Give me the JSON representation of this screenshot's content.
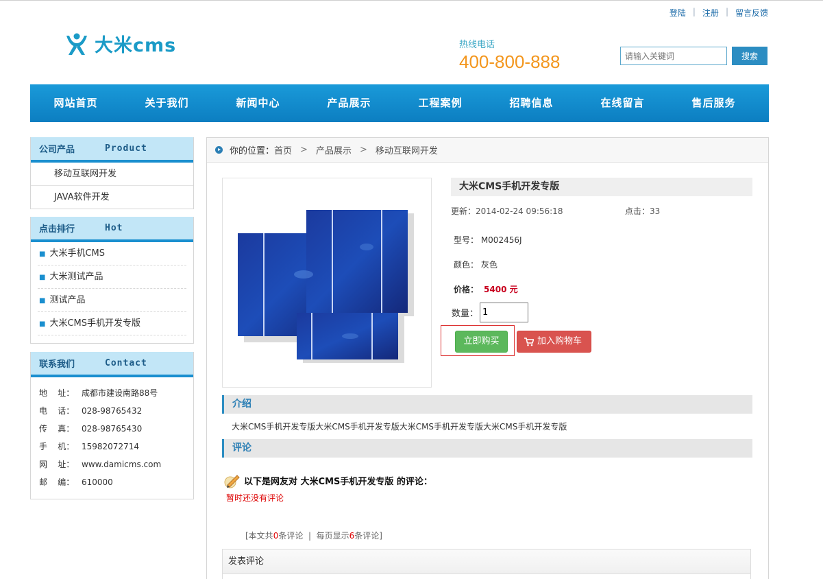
{
  "top_links": [
    "登陆",
    "注册",
    "留言反馈"
  ],
  "logo": {
    "text": "大米cms"
  },
  "hotline": {
    "label": "热线电话",
    "number": "400-800-888"
  },
  "search": {
    "placeholder": "请输入关键词",
    "button": "搜索"
  },
  "nav": [
    "网站首页",
    "关于我们",
    "新闻中心",
    "产品展示",
    "工程案例",
    "招聘信息",
    "在线留言",
    "售后服务"
  ],
  "sidebar": {
    "products": {
      "title": "公司产品",
      "title_en": "Product",
      "items": [
        "移动互联网开发",
        "JAVA软件开发"
      ]
    },
    "hot": {
      "title": "点击排行",
      "title_en": "Hot",
      "items": [
        "大米手机CMS",
        "大米测试产品",
        "测试产品",
        "大米CMS手机开发专版"
      ]
    },
    "contact": {
      "title": "联系我们",
      "title_en": "Contact",
      "rows": [
        {
          "k": "地    址：",
          "v": "成都市建设南路88号"
        },
        {
          "k": "电    话：",
          "v": "028-98765432"
        },
        {
          "k": "传    真：",
          "v": "028-98765430"
        },
        {
          "k": "手    机：",
          "v": "15982072714"
        },
        {
          "k": "网    址：",
          "v": "www.damicms.com"
        },
        {
          "k": "邮    编：",
          "v": "610000"
        }
      ]
    }
  },
  "breadcrumb": {
    "label": "你的位置：",
    "items": [
      "首页",
      "产品展示",
      "移动互联网开发"
    ]
  },
  "product": {
    "title": "大米CMS手机开发专版",
    "updated": "更新：2014-02-24 09:56:18",
    "hits": "点击：33",
    "model": "型号： M002456J",
    "color": "颜色： 灰色",
    "price_label": "价格：",
    "price_value": "5400 元",
    "qty_label": "数量：",
    "qty_value": "1",
    "buy_button": "立即购买",
    "cart_button": "加入购物车"
  },
  "intro": {
    "title": "介绍",
    "text": "大米CMS手机开发专版大米CMS手机开发专版大米CMS手机开发专版大米CMS手机开发专版"
  },
  "comments": {
    "title": "评论",
    "heading": "以下是网友对 大米CMS手机开发专版 的评论：",
    "none": "暂时还没有评论",
    "stat_prefix": "[本文共",
    "count": "0",
    "stat_mid": "条评论  |  每页显示",
    "per_page": "6",
    "stat_suffix": "条评论]",
    "post_title": "发表评论"
  },
  "colors": {
    "nav": "#0c7ec1",
    "accent": "#f3961d",
    "price": "#c8001e",
    "buy": "#5cb85c",
    "cart": "#d9534f"
  }
}
